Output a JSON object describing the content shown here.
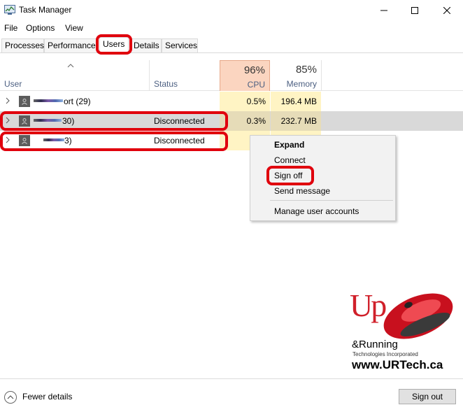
{
  "window": {
    "title": "Task Manager"
  },
  "menu": [
    "File",
    "Options",
    "View"
  ],
  "tabs": [
    "Processes",
    "Performance",
    "Users",
    "Details",
    "Services"
  ],
  "active_tab": "Users",
  "header": {
    "user": "User",
    "status": "Status",
    "cpu_pct": "96%",
    "cpu_label": "CPU",
    "memory_pct": "85%",
    "memory_label": "Memory"
  },
  "rows": [
    {
      "name": "ort (29)",
      "status": "",
      "cpu": "0.5%",
      "memory": "196.4 MB"
    },
    {
      "name": "30)",
      "status": "Disconnected",
      "cpu": "0.3%",
      "memory": "232.7 MB"
    },
    {
      "name": "3)",
      "status": "Disconnected",
      "cpu": "",
      "memory": ""
    }
  ],
  "context_menu": [
    "Expand",
    "Connect",
    "Sign off",
    "Send message",
    "Manage user accounts"
  ],
  "logo": {
    "up": "Up",
    "amp_running": "&Running",
    "tagline": "Technologies Incorporated",
    "site": "www.URTech.ca"
  },
  "footer": {
    "fewer_details": "Fewer details",
    "sign_out": "Sign out"
  },
  "colors": {
    "highlight": "#e0000d",
    "cpu_header": "#fbd5c0",
    "heat": "#fff4c4",
    "selected_row": "#d9d9d9"
  }
}
